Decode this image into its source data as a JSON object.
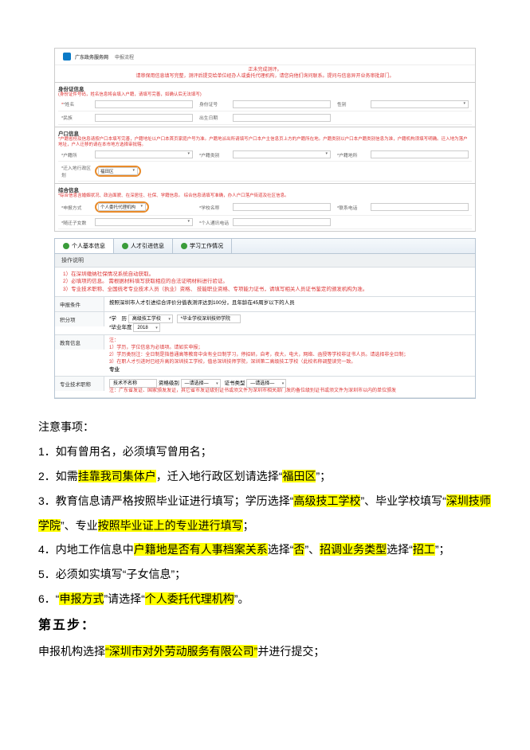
{
  "shot1": {
    "site": "广东政务服务网",
    "bc": "申报流程",
    "banner_line1": "正未完成测评。",
    "banner_line2": "请审保用信息填写完整，测评后提交给单位经办人或委托代理机构，请您向他们询问联系。提问与信息异开业务审批部门。",
    "sect_id": "身份证信息",
    "sect_id_note": "(身份证件号码，姓名信息将会填入户籍，请填写完善，如确认后无法填写)",
    "name_lbl": "*姓名",
    "idcard_lbl": "身份证号",
    "sex_lbl": "性别",
    "nation_lbl": "*民族",
    "birth_lbl": "出生日期",
    "sect_hk": "户口信息",
    "sect_hk_note": "*户籍省份及信息请按户口本填写完善，户籍地址以户口本首页家庭户号为准。户籍地派出所请填写户口本户主信息页上方的户籍所在地。户籍类别以户口本户籍类别信息为准，户籍机构须填写明确。迁入地为落户地址，户人迁移的请在本市地方选择审批辖。",
    "huji_lbl": "*户籍所",
    "huji_type_lbl": "*户籍类别",
    "huji_type_lbl2": "*户籍地所",
    "move_lbl": "*迁入地行政区划",
    "move_val": "福田区",
    "sect_zh": "综合信息",
    "sect_zh_note": "*综合信息含婚姻状况、政治面貌、在深居住、社保、学籍信息。 综合信息请填写准确，办人户口落户街道及社区信息。",
    "sb_lbl": "*申报方式",
    "sb_val": "个人委托代理机构",
    "xx_lbl": "*学校名称",
    "lx_lbl": "*联系电话",
    "sx_lbl": "*随迁子女数",
    "sx2_lbl": "*个人通讯电话",
    "s2_tabs": [
      "个人基本信息",
      "人才引进信息",
      "学习工作情况"
    ],
    "s2_box_title": "操作说明",
    "s2_box_l1": "1）在深圳缴纳社保情况系统自动获取。",
    "s2_box_l2": "2）必填项的信息。 需根据材料填写获取相应的合法证明材料进行验证。",
    "s2_box_l3": "3）专业技术职称、全国统考专业技术人员（执业）资格、 技能职业资格、专项能力证书，请填写相关人员证书鉴定的颁发机构为准。",
    "s2_cond_lbl": "申报条件",
    "s2_cond_val": "按照深圳市人才引进综合评价分值表测评达到100分，且年龄在45周岁以下的人员",
    "s2_score_lbl": "积分项",
    "s2_edu_lbl": "教育信息",
    "s2_edu_a": "*学　历",
    "s2_edu_a_val": "高级技工学校",
    "s2_edu_b": "*毕业学校深圳技师学院",
    "s2_edu_c": "*毕业年度",
    "s2_edu_c_val": "2018",
    "s2_edu_note1": "注：",
    "s2_edu_note2": "1）学历，学位信息为必填项。请如实申报；",
    "s2_edu_note3": "2）学历类别注：全日制是指普通高等教育中含有全日制学习，停招研，自考，夜大，电大，网络、函授等学校非证书人员。请选择非全日制；",
    "s2_edu_note4": "3）在职人才引进时已经升高的深圳技工学校，值总深圳技师学院，深圳第二高级技工学校（此校名称调整读完一致。",
    "s2_pro_lbl": "专业",
    "s2_zy_lbl": "专业技术职称",
    "s2_zy_val": "技术不名称",
    "s2_zy_a": "资格级别",
    "s2_zy_a_ph": "—请选择—",
    "s2_zy_b": "证书类型",
    "s2_zy_b_ph": "—请选择—",
    "s2_zy_note": "注：广东省发证、国家颁发发证，其它省市发证级别证书或须文件为深圳市相关部门发的备位级别证书或须文件为深圳市以内的单位颁发"
  },
  "doc": {
    "head": "注意事项：",
    "l1a": "1．如有曾用名，必须填写曾用名；",
    "l2a": "2．如需",
    "l2b": "挂靠我司集体户",
    "l2c": "，迁入地行政区划请选择“",
    "l2d": "福田区",
    "l2e": "”；",
    "l3a": "3．教育信息请严格按照毕业证进行填写；学历选择“",
    "l3b": "高级技工学校",
    "l3c": "”、毕业学校填写“",
    "l3d": "深圳技师学院",
    "l3e": "”、专业",
    "l3f": "按照毕业证上的专业进行填写",
    "l3g": "；",
    "l4a": "4．内地工作信息中",
    "l4b": "户籍地是否有人事档案关系",
    "l4c": "选择“",
    "l4d": "否",
    "l4e": "”、",
    "l4f": "招调业务类型",
    "l4g": "选择“",
    "l4h": "招工",
    "l4i": "”；",
    "l5": "5．必须如实填写“子女信息”；",
    "l6a": "6．“",
    "l6b": "申报方式",
    "l6c": "”请选择“",
    "l6d": "个人委托代理机构",
    "l6e": "”。",
    "step": "第五步：",
    "s5a": "申报机构选择",
    "s5b": "“深圳市对外劳动服务有限公司”",
    "s5c": "并进行提交；"
  }
}
